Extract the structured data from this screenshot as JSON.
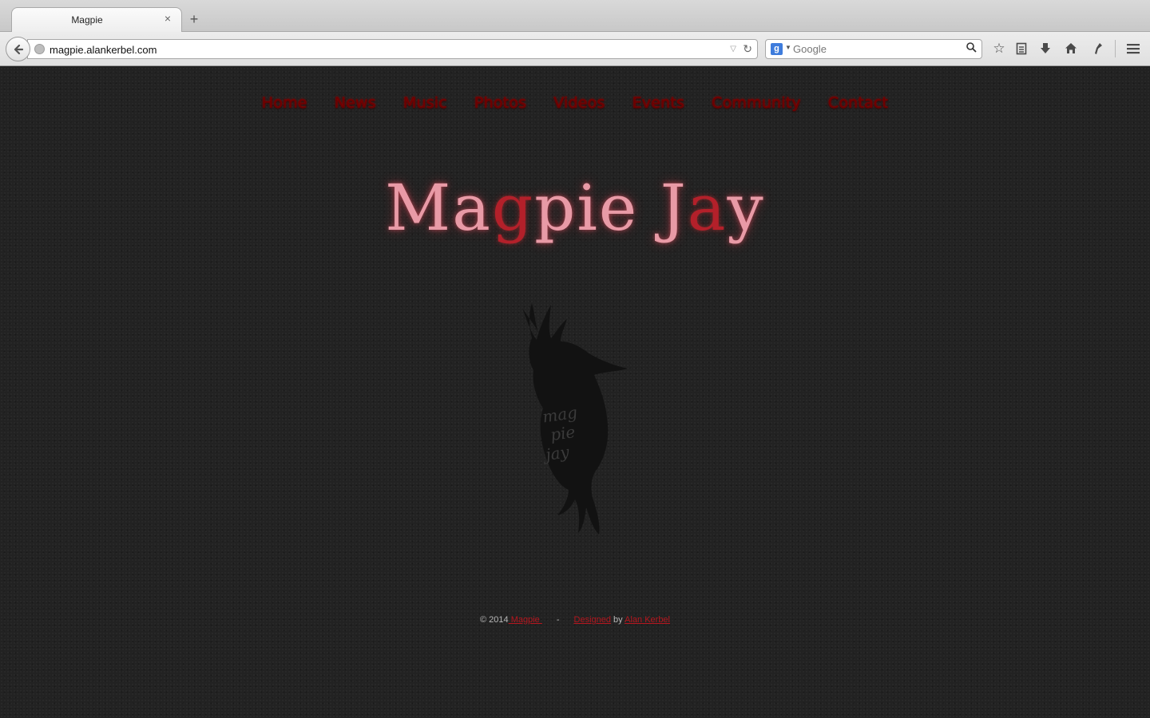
{
  "browser": {
    "tab": {
      "title": "Magpie",
      "close_glyph": "×"
    },
    "new_tab_glyph": "+",
    "url": "magpie.alankerbel.com",
    "search": {
      "engine_badge": "g",
      "placeholder": "Google"
    },
    "toolbar_icons": [
      "bookmark-star-icon",
      "reading-list-icon",
      "downloads-icon",
      "home-icon",
      "feedback-icon",
      "menu-icon"
    ]
  },
  "site": {
    "nav": {
      "home": "Home",
      "news": "News",
      "music": "Music",
      "photos": "Photos",
      "videos": "Videos",
      "events": "Events",
      "community": "Community",
      "contact": "Contact"
    },
    "title": {
      "part1": "Ma",
      "part2": "g",
      "part3": "pie ",
      "part4": "J",
      "part5": "a",
      "part6": "y"
    },
    "logo_text": [
      "mag",
      "pie",
      "jay"
    ],
    "footer": {
      "copyright": "© 2014",
      "site_link": " Magpie ",
      "separator": "-",
      "designed_link": "Designed",
      "by": " by ",
      "author_link": "Alan Kerbel"
    },
    "colors": {
      "nav_text": "#6b0000",
      "title_light": "#e89aa6",
      "title_dark": "#b3202a",
      "link": "#b5171f",
      "background": "#222222"
    }
  }
}
